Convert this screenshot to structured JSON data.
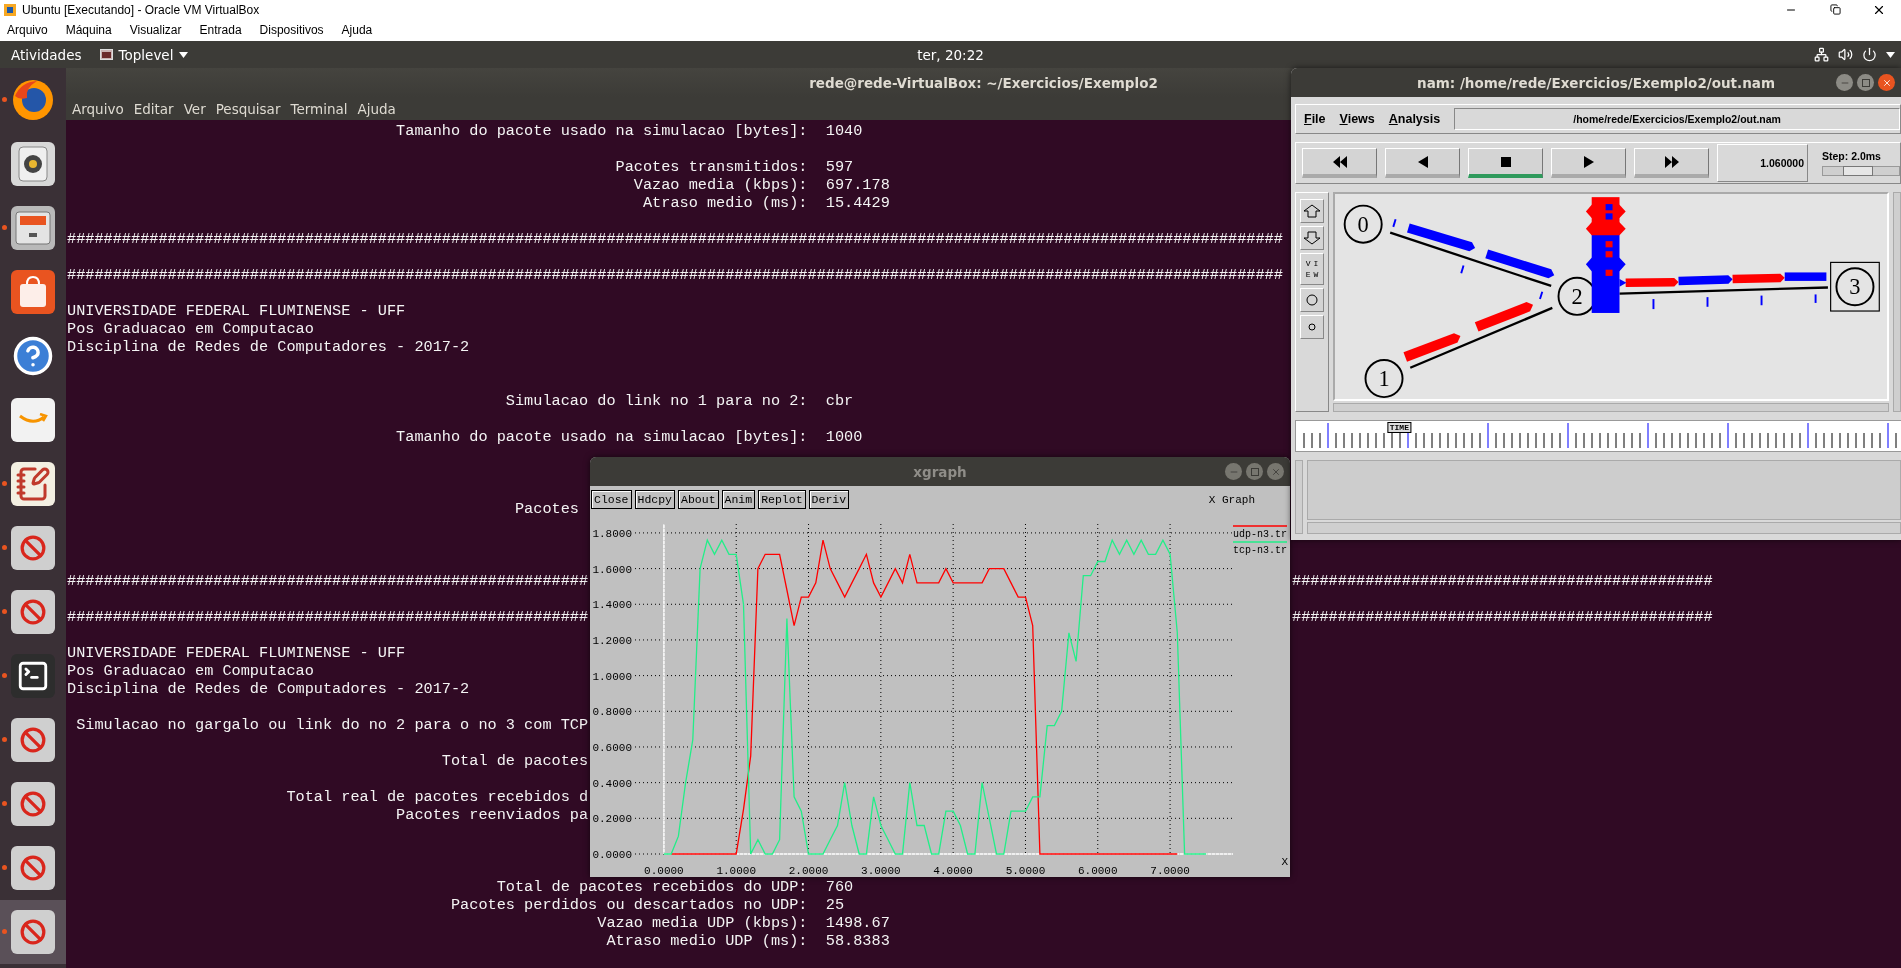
{
  "host_window": {
    "title": "Ubuntu [Executando] - Oracle VM VirtualBox",
    "menu": [
      "Arquivo",
      "Máquina",
      "Visualizar",
      "Entrada",
      "Dispositivos",
      "Ajuda"
    ]
  },
  "top_bar": {
    "activities": "Atividades",
    "app_menu": "Toplevel",
    "clock": "ter, 20:22"
  },
  "dock": [
    {
      "kind": "browser",
      "running": true,
      "selected": false
    },
    {
      "kind": "music",
      "running": false,
      "selected": false
    },
    {
      "kind": "files",
      "running": true,
      "selected": false
    },
    {
      "kind": "store",
      "running": false,
      "selected": false
    },
    {
      "kind": "help",
      "running": false,
      "selected": false
    },
    {
      "kind": "shop",
      "running": false,
      "selected": false
    },
    {
      "kind": "editor",
      "running": true,
      "selected": false
    },
    {
      "kind": "blocked",
      "running": true,
      "selected": false
    },
    {
      "kind": "blocked",
      "running": true,
      "selected": false
    },
    {
      "kind": "terminal",
      "running": true,
      "selected": false
    },
    {
      "kind": "blocked",
      "running": true,
      "selected": false
    },
    {
      "kind": "blocked",
      "running": true,
      "selected": false
    },
    {
      "kind": "blocked",
      "running": true,
      "selected": false
    },
    {
      "kind": "blocked",
      "running": true,
      "selected": true
    }
  ],
  "terminal": {
    "title": "rede@rede-VirtualBox: ~/Exercicios/Exemplo2",
    "menu": [
      "Arquivo",
      "Editar",
      "Ver",
      "Pesquisar",
      "Terminal",
      "Ajuda"
    ],
    "lines": [
      {
        "kind": "text",
        "segments": [
          "                                    Tamanho do pacote usado na simulacao [bytes]:  1040"
        ]
      },
      {
        "kind": "blank"
      },
      {
        "kind": "text",
        "segments": [
          "                                                            Pacotes transmitidos:  597"
        ]
      },
      {
        "kind": "text",
        "segments": [
          "                                                              Vazao media (kbps):  697.178"
        ]
      },
      {
        "kind": "text",
        "segments": [
          "                                                               Atraso medio (ms):  15.4429"
        ]
      },
      {
        "kind": "blank"
      },
      {
        "kind": "text",
        "segments": [
          "#####################################################################################################################################"
        ]
      },
      {
        "kind": "blank"
      },
      {
        "kind": "text",
        "segments": [
          "#####################################################################################################################################"
        ]
      },
      {
        "kind": "blank"
      },
      {
        "kind": "text",
        "segments": [
          "UNIVERSIDADE FEDERAL FLUMINENSE - UFF"
        ]
      },
      {
        "kind": "text",
        "segments": [
          "Pos Graduacao em Computacao"
        ]
      },
      {
        "kind": "text",
        "segments": [
          "Disciplina de Redes de Computadores - 2017-2"
        ]
      },
      {
        "kind": "blank"
      },
      {
        "kind": "blank"
      },
      {
        "kind": "text",
        "segments": [
          "                                                Simulacao do link no 1 para no 2:  cbr"
        ]
      },
      {
        "kind": "blank"
      },
      {
        "kind": "text",
        "segments": [
          "                                    Tamanho do pacote usado na simulacao [bytes]:  1000"
        ]
      },
      {
        "kind": "blank"
      },
      {
        "kind": "blank"
      },
      {
        "kind": "blank"
      },
      {
        "kind": "text",
        "segments": [
          "                                                 Pacotes"
        ]
      },
      {
        "kind": "blank"
      },
      {
        "kind": "blank"
      },
      {
        "kind": "blank"
      },
      {
        "kind": "text",
        "segments": [
          "#########################################################",
          "                                                                             ##############################################"
        ]
      },
      {
        "kind": "blank"
      },
      {
        "kind": "text",
        "segments": [
          "#########################################################",
          "                                                                             ##############################################"
        ]
      },
      {
        "kind": "blank"
      },
      {
        "kind": "text",
        "segments": [
          "UNIVERSIDADE FEDERAL FLUMINENSE - UFF"
        ]
      },
      {
        "kind": "text",
        "segments": [
          "Pos Graduacao em Computacao"
        ]
      },
      {
        "kind": "text",
        "segments": [
          "Disciplina de Redes de Computadores - 2017-2"
        ]
      },
      {
        "kind": "blank"
      },
      {
        "kind": "text",
        "segments": [
          " Simulacao no gargalo ou link do no 2 para o no 3 com TCP"
        ]
      },
      {
        "kind": "blank"
      },
      {
        "kind": "text",
        "segments": [
          "                                         Total de pacotes"
        ]
      },
      {
        "kind": "blank"
      },
      {
        "kind": "text",
        "segments": [
          "                        Total real de pacotes recebidos d"
        ]
      },
      {
        "kind": "text",
        "segments": [
          "                                    Pacotes reenviados pa"
        ]
      },
      {
        "kind": "blank"
      },
      {
        "kind": "blank"
      },
      {
        "kind": "blank"
      },
      {
        "kind": "text",
        "segments": [
          "                                               Total de pacotes recebidos do UDP:  760"
        ]
      },
      {
        "kind": "text",
        "segments": [
          "                                          Pacotes perdidos ou descartados no UDP:  25"
        ]
      },
      {
        "kind": "text",
        "segments": [
          "                                                          Vazao media UDP (kbps):  1498.67"
        ]
      },
      {
        "kind": "text",
        "segments": [
          "                                                           Atraso medio UDP (ms):  58.8383"
        ]
      }
    ]
  },
  "xgraph": {
    "title": "xgraph",
    "buttons": [
      "Close",
      "Hdcpy",
      "About",
      "Anim",
      "Replot",
      "Deriv"
    ],
    "chart_data": {
      "type": "line",
      "grid": true,
      "title": "X Graph",
      "xlabel": "X",
      "x": [
        0,
        0.1,
        0.2,
        0.3,
        0.4,
        0.5,
        0.6,
        0.7,
        0.8,
        0.9,
        1,
        1.1,
        1.2,
        1.3,
        1.4,
        1.5,
        1.6,
        1.7,
        1.8,
        1.9,
        2,
        2.1,
        2.2,
        2.3,
        2.4,
        2.5,
        2.6,
        2.7,
        2.8,
        2.9,
        3,
        3.1,
        3.2,
        3.3,
        3.4,
        3.5,
        3.6,
        3.7,
        3.8,
        3.9,
        4,
        4.1,
        4.2,
        4.3,
        4.4,
        4.5,
        4.6,
        4.7,
        4.8,
        4.9,
        5,
        5.1,
        5.2,
        5.3,
        5.4,
        5.5,
        5.6,
        5.7,
        5.8,
        5.9,
        6,
        6.1,
        6.2,
        6.3,
        6.4,
        6.5,
        6.6,
        6.7,
        6.8,
        6.9,
        7,
        7.1,
        7.2,
        7.3,
        7.4,
        7.5
      ],
      "series": [
        {
          "name": "udp-n3.tr",
          "color": "#ff0000",
          "values": [
            null,
            0,
            0,
            0,
            0,
            0,
            0,
            0,
            0,
            0,
            0,
            0.25,
            0.55,
            1.6,
            1.68,
            1.68,
            1.68,
            1.48,
            1.28,
            1.44,
            1.44,
            1.52,
            1.76,
            1.6,
            1.52,
            1.44,
            1.52,
            1.6,
            1.68,
            1.52,
            1.44,
            1.52,
            1.6,
            1.52,
            1.68,
            1.52,
            1.52,
            1.52,
            1.52,
            1.6,
            1.52,
            1.52,
            1.52,
            1.52,
            1.52,
            1.6,
            1.6,
            1.6,
            1.52,
            1.44,
            1.44,
            1.28,
            0,
            0,
            0,
            0,
            0,
            0,
            0,
            0,
            0,
            0,
            0,
            0,
            0,
            0,
            0,
            0,
            0,
            0,
            0,
            0,
            null,
            null,
            null,
            null
          ]
        },
        {
          "name": "tcp-n3.tr",
          "color": "#22ee88",
          "values": [
            0,
            0,
            0.1,
            0.4,
            0.64,
            1.6,
            1.76,
            1.68,
            1.76,
            1.68,
            1.68,
            1.4,
            0,
            0.08,
            0,
            0,
            0.08,
            1.32,
            0.32,
            0.24,
            0,
            0,
            0,
            0.08,
            0.16,
            0.4,
            0.16,
            0,
            0,
            0.32,
            0.16,
            0.08,
            0,
            0,
            0.4,
            0.16,
            0.16,
            0,
            0,
            0.24,
            0.24,
            0.16,
            0,
            0,
            0.4,
            0.2,
            0,
            0,
            0.24,
            0.24,
            0.24,
            0.32,
            0.32,
            0.72,
            0.72,
            0.8,
            1.24,
            1.08,
            1.56,
            1.56,
            1.64,
            1.64,
            1.76,
            1.68,
            1.76,
            1.68,
            1.76,
            1.68,
            1.68,
            1.76,
            1.68,
            1.24,
            0,
            0,
            0,
            0
          ]
        }
      ],
      "xlim": [
        -0.4,
        7.87
      ],
      "ylim": [
        0,
        1.85
      ],
      "xticks": [
        {
          "value": 0,
          "label": "0.0000"
        },
        {
          "value": 1,
          "label": "1.0000"
        },
        {
          "value": 2,
          "label": "2.0000"
        },
        {
          "value": 3,
          "label": "3.0000"
        },
        {
          "value": 4,
          "label": "4.0000"
        },
        {
          "value": 5,
          "label": "5.0000"
        },
        {
          "value": 6,
          "label": "6.0000"
        },
        {
          "value": 7,
          "label": "7.0000"
        }
      ],
      "yticks": [
        {
          "value": 0,
          "label": "0.0000"
        },
        {
          "value": 0.2,
          "label": "0.2000"
        },
        {
          "value": 0.4,
          "label": "0.4000"
        },
        {
          "value": 0.6,
          "label": "0.6000"
        },
        {
          "value": 0.8,
          "label": "0.8000"
        },
        {
          "value": 1,
          "label": "1.0000"
        },
        {
          "value": 1.2,
          "label": "1.2000"
        },
        {
          "value": 1.4,
          "label": "1.4000"
        },
        {
          "value": 1.6,
          "label": "1.6000"
        },
        {
          "value": 1.8,
          "label": "1.8000"
        }
      ]
    }
  },
  "nam": {
    "title": "nam: /home/rede/Exercicios/Exemplo2/out.nam",
    "menu": [
      "File",
      "Views",
      "Analysis"
    ],
    "path": "/home/rede/Exercicios/Exemplo2/out.nam",
    "controls": [
      {
        "kind": "rewind",
        "selected": false
      },
      {
        "kind": "back",
        "selected": false
      },
      {
        "kind": "stop",
        "selected": true
      },
      {
        "kind": "play",
        "selected": false
      },
      {
        "kind": "forward",
        "selected": false
      }
    ],
    "time": "1.060000",
    "step": {
      "label": "Step: 2.0ms",
      "level": 0.45
    },
    "tools": [
      {
        "kind": "zoom-in"
      },
      {
        "kind": "zoom-out"
      },
      {
        "kind": "view",
        "label": "VIEW"
      },
      {
        "kind": "circle"
      },
      {
        "kind": "dot"
      }
    ],
    "nodes": [
      {
        "label": "0",
        "kind": "circle"
      },
      {
        "label": "1",
        "kind": "circle"
      },
      {
        "label": "2",
        "kind": "circle"
      },
      {
        "label": "3",
        "kind": "boxed"
      }
    ],
    "timeline": {
      "label": "TIME",
      "level": 0.17
    }
  }
}
